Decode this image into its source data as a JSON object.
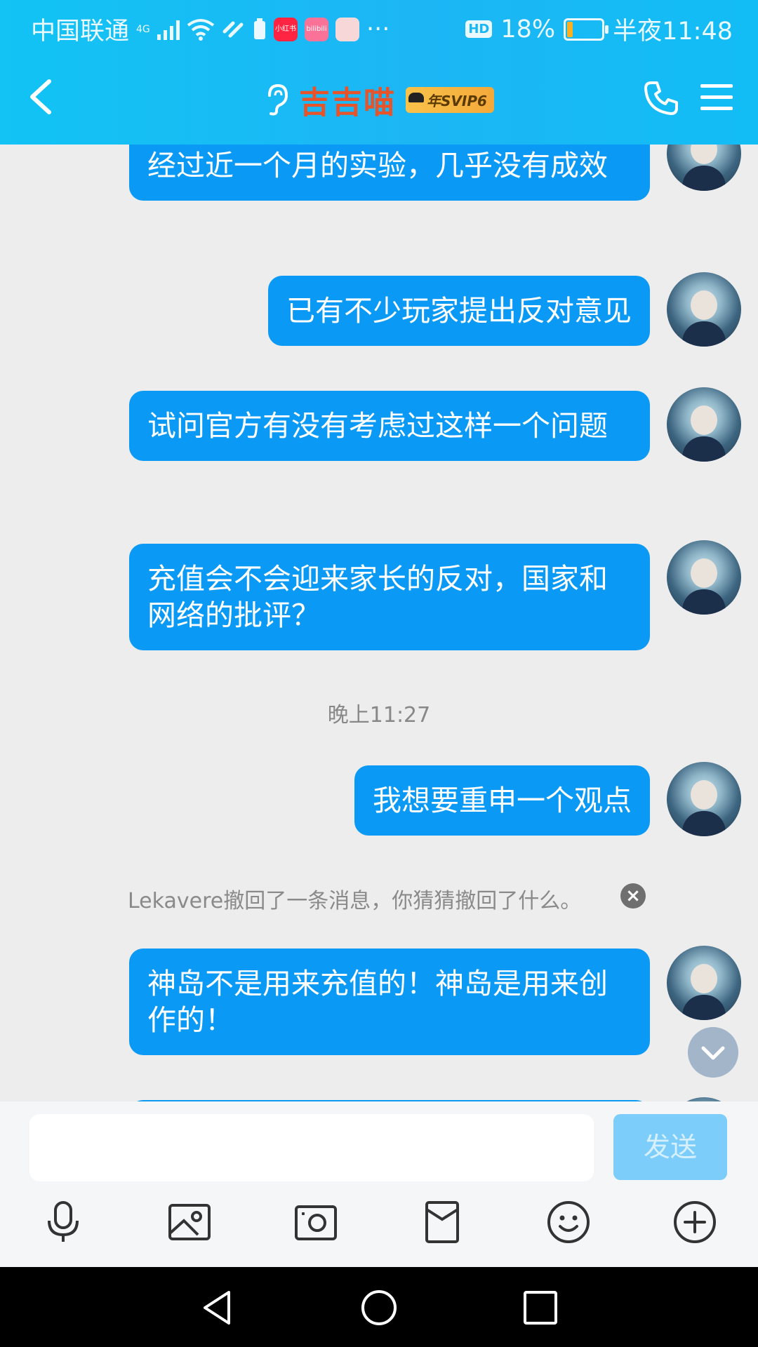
{
  "status_bar": {
    "carrier": "中国联通",
    "network": "4G",
    "app_badges": [
      "小红书",
      "bilibili",
      ""
    ],
    "more": "···",
    "hd": "HD",
    "battery": "18%",
    "time": "半夜11:48"
  },
  "header": {
    "title": "吉吉喵",
    "vip_badge": "年SVIP6"
  },
  "messages": [
    {
      "text": "经过近一个月的实验，几乎没有成效"
    },
    {
      "text": "已有不少玩家提出反对意见"
    },
    {
      "text": "试问官方有没有考虑过这样一个问题"
    },
    {
      "text": "充值会不会迎来家长的反对，国家和网络的批评？"
    },
    {
      "text": "我想要重申一个观点"
    },
    {
      "text": "神岛不是用来充值的！神岛是用来创作的！"
    }
  ],
  "timestamp": "晚上11:27",
  "system_message": "Lekavere撤回了一条消息，你猜猜撤回了什么。",
  "input": {
    "placeholder": "",
    "send_label": "发送"
  },
  "colors": {
    "header": "#1cb6f5",
    "bubble": "#0b99f6",
    "title": "#e8532a",
    "background": "#ededed"
  },
  "icons": [
    "microphone-icon",
    "photo-icon",
    "camera-icon",
    "red-packet-icon",
    "emoji-icon",
    "plus-icon"
  ]
}
